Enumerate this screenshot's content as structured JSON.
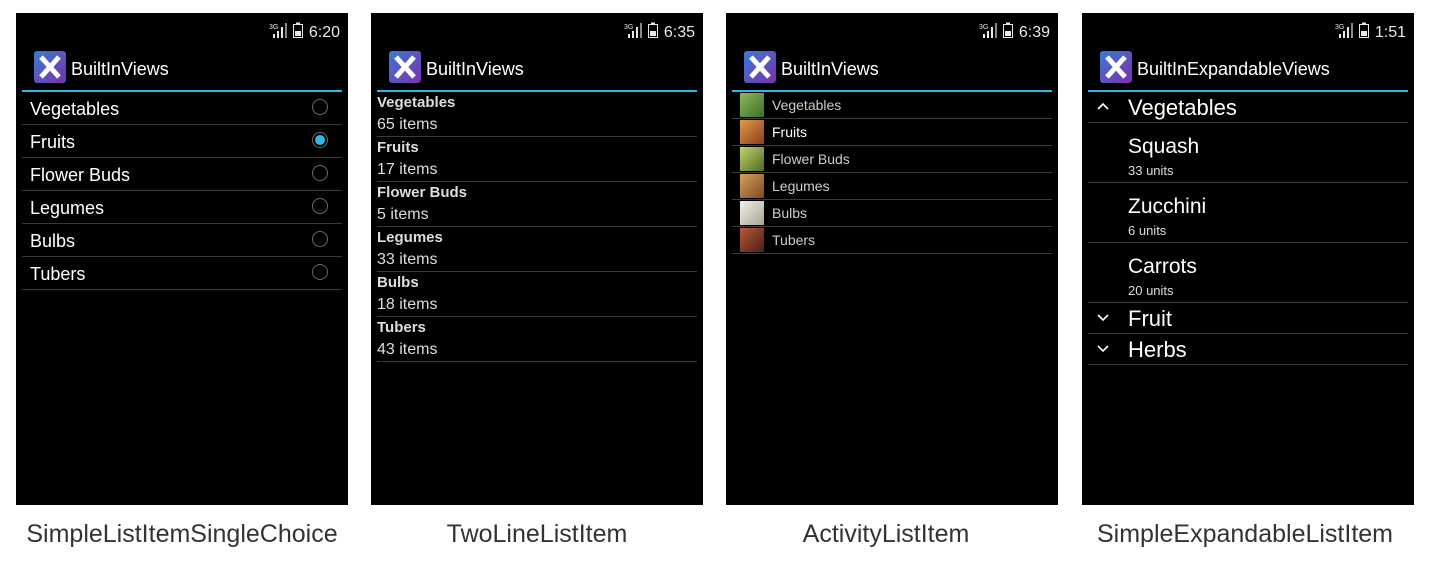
{
  "colors": {
    "accent": "#33b5e5",
    "background": "#000000"
  },
  "screens": [
    {
      "status_time": "6:20",
      "app_title": "BuiltInViews",
      "caption": "SimpleListItemSingleChoice",
      "items": [
        {
          "label": "Vegetables",
          "checked": false
        },
        {
          "label": "Fruits",
          "checked": true
        },
        {
          "label": "Flower Buds",
          "checked": false
        },
        {
          "label": "Legumes",
          "checked": false
        },
        {
          "label": "Bulbs",
          "checked": false
        },
        {
          "label": "Tubers",
          "checked": false
        }
      ]
    },
    {
      "status_time": "6:35",
      "app_title": "BuiltInViews",
      "caption": "TwoLineListItem",
      "items": [
        {
          "title": "Vegetables",
          "subtitle": "65 items"
        },
        {
          "title": "Fruits",
          "subtitle": "17 items"
        },
        {
          "title": "Flower Buds",
          "subtitle": "5 items"
        },
        {
          "title": "Legumes",
          "subtitle": "33 items"
        },
        {
          "title": "Bulbs",
          "subtitle": "18 items"
        },
        {
          "title": "Tubers",
          "subtitle": "43 items"
        }
      ]
    },
    {
      "status_time": "6:39",
      "app_title": "BuiltInViews",
      "caption": "ActivityListItem",
      "items": [
        {
          "label": "Vegetables",
          "thumb_color": "#5b8a3c"
        },
        {
          "label": "Fruits",
          "thumb_color": "#c46a2a"
        },
        {
          "label": "Flower Buds",
          "thumb_color": "#8aa640"
        },
        {
          "label": "Legumes",
          "thumb_color": "#b5773a"
        },
        {
          "label": "Bulbs",
          "thumb_color": "#d8d4c8"
        },
        {
          "label": "Tubers",
          "thumb_color": "#8c3a2a"
        }
      ]
    },
    {
      "status_time": "1:51",
      "app_title": "BuiltInExpandableViews",
      "caption": "SimpleExpandableListItem",
      "groups": [
        {
          "label": "Vegetables",
          "expanded": true,
          "chevron": "^",
          "children": [
            {
              "name": "Squash",
              "detail": "33 units"
            },
            {
              "name": "Zucchini",
              "detail": "6 units"
            },
            {
              "name": "Carrots",
              "detail": "20 units"
            }
          ]
        },
        {
          "label": "Fruit",
          "expanded": false,
          "chevron": "⌄",
          "children": []
        },
        {
          "label": "Herbs",
          "expanded": false,
          "chevron": "⌄",
          "children": []
        }
      ]
    }
  ],
  "status_icons": {
    "network": "3G",
    "signal": "signal-icon",
    "battery": "battery-icon"
  }
}
